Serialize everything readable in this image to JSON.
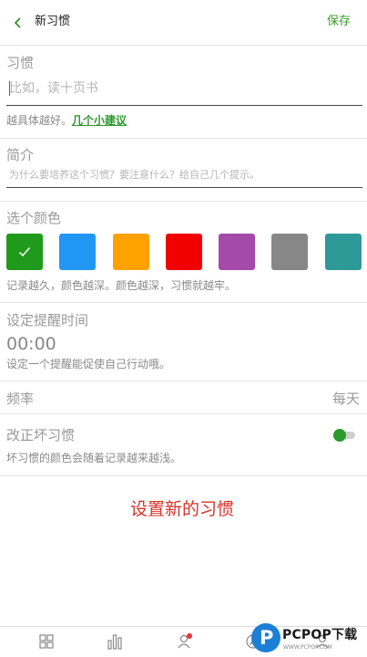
{
  "header": {
    "title": "新习惯",
    "save_label": "保存"
  },
  "habit": {
    "label": "习惯",
    "placeholder": "比如，读十页书",
    "note_prefix": "越具体越好。",
    "note_link": "几个小建议"
  },
  "intro": {
    "label": "简介",
    "placeholder": "为什么要培养这个习惯？要注意什么？给自己几个提示。"
  },
  "color": {
    "label": "选个颜色",
    "swatches": [
      "#1f9a1b",
      "#2196f3",
      "#ffa200",
      "#f20000",
      "#a44aa8",
      "#878787",
      "#2e9a98"
    ],
    "selected_index": 0,
    "note": "记录越久，颜色越深。颜色越深，习惯就越牢。"
  },
  "reminder": {
    "label": "设定提醒时间",
    "time": "00:00",
    "note": "设定一个提醒能促使自己行动哦。"
  },
  "frequency": {
    "label": "频率",
    "value": "每天"
  },
  "bad_habit": {
    "label": "改正坏习惯",
    "note": "坏习惯的颜色会随着记录越来越浅。",
    "enabled": false
  },
  "submit_label": "设置新的习惯",
  "tabbar": {
    "icons": [
      "grid-icon",
      "bar-chart-icon",
      "user-icon",
      "compass-icon",
      "profile-icon"
    ],
    "badge_tab": "user-icon"
  },
  "watermark": {
    "mark": "P",
    "text": "PCPOP下载",
    "sub": "WWW.PCPOP.COM"
  }
}
